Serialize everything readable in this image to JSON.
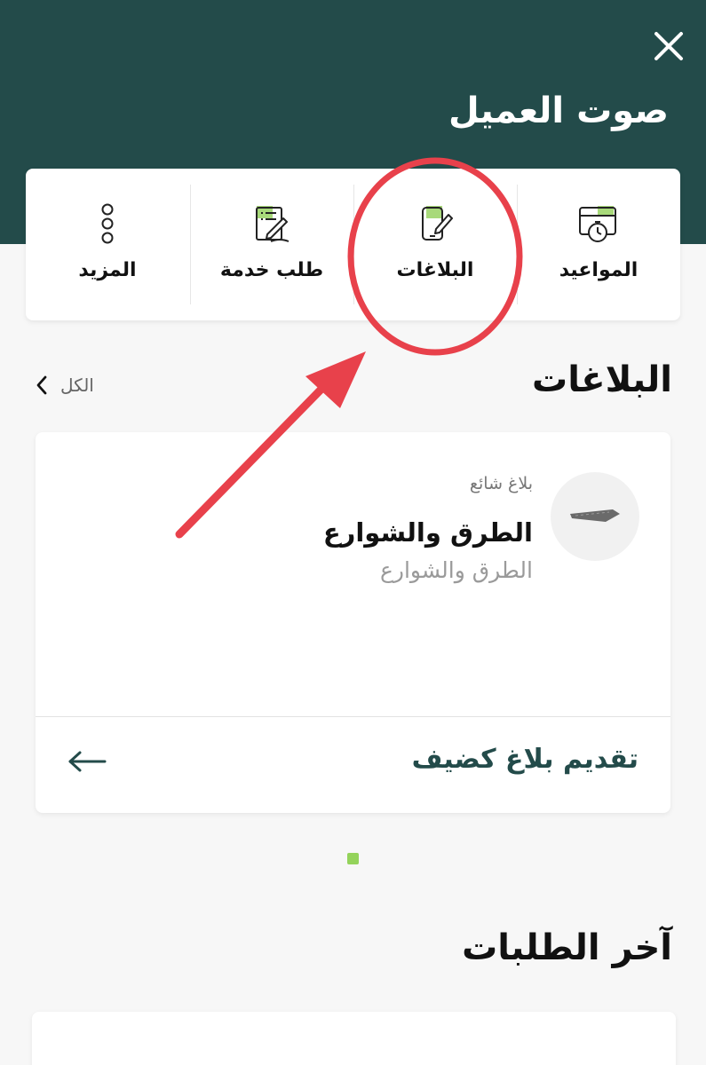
{
  "header": {
    "title": "صوت العميل",
    "background_color": "#234b4a"
  },
  "quick_actions": [
    {
      "label": "المواعيد",
      "icon": "calendar-clock-icon"
    },
    {
      "label": "البلاغات",
      "icon": "phone-edit-icon"
    },
    {
      "label": "طلب خدمة",
      "icon": "document-edit-icon"
    },
    {
      "label": "المزيد",
      "icon": "more-vertical-icon"
    }
  ],
  "reports_section": {
    "title": "البلاغات",
    "see_all": "الكل"
  },
  "report_card": {
    "badge": "بلاغ شائع",
    "title": "الطرق والشوارع",
    "subtitle": "الطرق والشوارع",
    "action_label": "تقديم بلاغ كضيف"
  },
  "pager": {
    "active_color": "#94d35b"
  },
  "latest_requests": {
    "title": "آخر الطلبات"
  },
  "annotation": {
    "color": "#e8414b"
  }
}
